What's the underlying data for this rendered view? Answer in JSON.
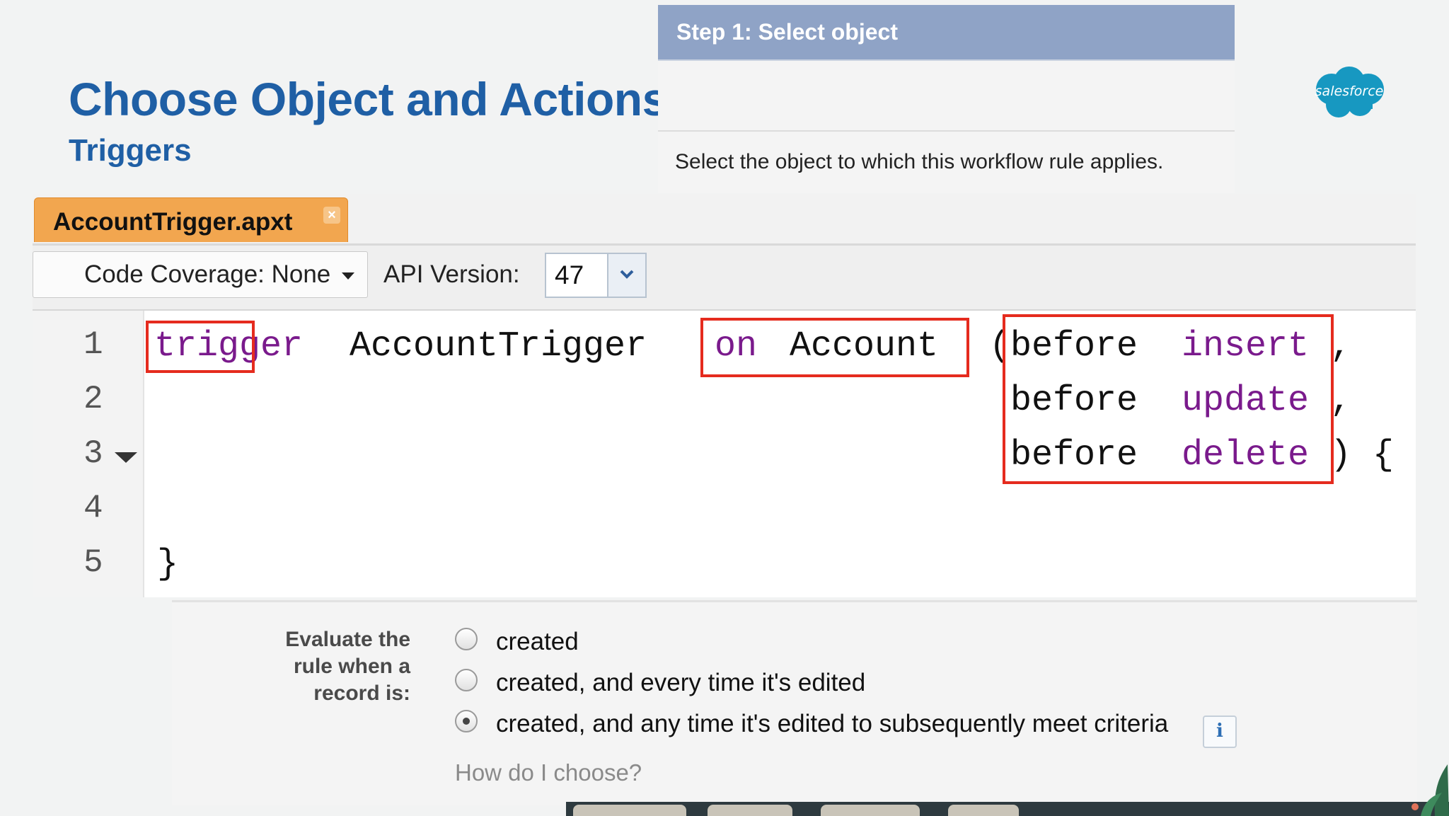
{
  "slide": {
    "title": "Choose Object and Actions",
    "subtitle": "Triggers",
    "logo_text": "salesforce",
    "brand_color": "#1f5fa5",
    "logo_color": "#1798c1"
  },
  "step_panel": {
    "header": "Step 1: Select object",
    "description": "Select the object to which this workflow rule applies."
  },
  "editor": {
    "tab_label": "AccountTrigger.apxt",
    "tab_close": "×",
    "coverage_label": "Code Coverage: None",
    "api_label": "API Version:",
    "api_value": "47",
    "line_numbers": [
      "1",
      "2",
      "3",
      "4",
      "5"
    ],
    "code": {
      "l1_kw_trigger": "trigger",
      "l1_name": "AccountTrigger",
      "l1_kw_on": "on",
      "l1_obj": "Account",
      "l1_paren": "(",
      "before": "before",
      "insert": "insert",
      "update": "update",
      "delete": "delete",
      "comma": ",",
      "close": ") {",
      "end": "}"
    },
    "highlight_color": "#e52b1e",
    "keyword_color": "#7a1a8c"
  },
  "evaluate": {
    "label_line1": "Evaluate the",
    "label_line2": "rule when a",
    "label_line3": "record is:",
    "options": [
      {
        "label": "created",
        "checked": false
      },
      {
        "label": "created, and every time it's edited",
        "checked": false
      },
      {
        "label": "created, and any time it's edited to subsequently meet criteria",
        "checked": true
      }
    ],
    "info_icon": "i",
    "help_link": "How do I choose?"
  }
}
